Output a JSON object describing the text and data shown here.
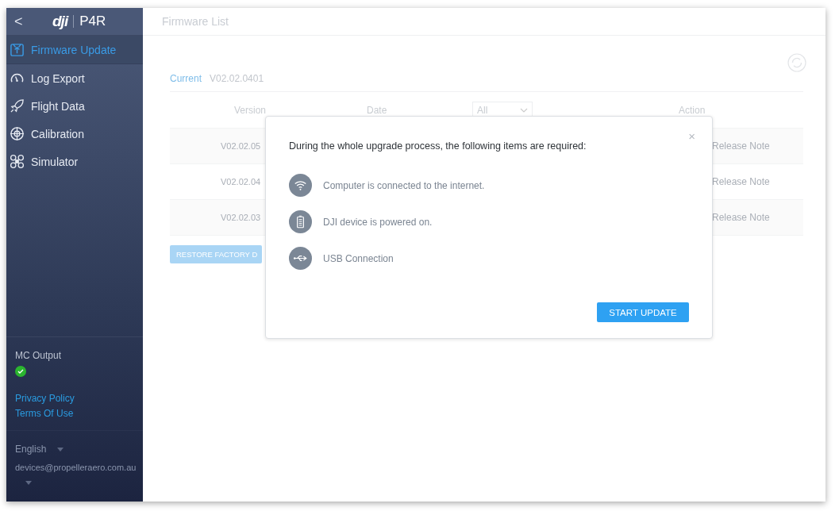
{
  "sidebar": {
    "back": "<",
    "logo": "dji",
    "model": "P4R",
    "items": [
      {
        "label": "Firmware Update",
        "kind": "firmware",
        "selected": true
      },
      {
        "label": "Log Export",
        "kind": "gauge",
        "selected": false
      },
      {
        "label": "Flight Data",
        "kind": "rocket",
        "selected": false
      },
      {
        "label": "Calibration",
        "kind": "target",
        "selected": false
      },
      {
        "label": "Simulator",
        "kind": "drone",
        "selected": false
      }
    ],
    "mc_output": {
      "label": "MC Output",
      "ok": true
    },
    "links": [
      "Privacy Policy",
      "Terms Of Use"
    ],
    "language": "English",
    "account": "devices@propelleraero.com.au"
  },
  "main": {
    "title": "Firmware List",
    "current_label": "Current",
    "current_version": "V02.02.0401",
    "table": {
      "columns": [
        "Version",
        "Date",
        "Action"
      ],
      "filter": "All",
      "rows": [
        {
          "version": "V02.02.05",
          "action": "Release Note"
        },
        {
          "version": "V02.02.04",
          "action": "Release Note"
        },
        {
          "version": "V02.02.03",
          "action": "Release Note"
        }
      ]
    },
    "restore_button": "RESTORE FACTORY D"
  },
  "dialog": {
    "message": "During the whole upgrade process, the following items are required:",
    "close": "×",
    "requirements": [
      {
        "kind": "wifi",
        "text": "Computer is connected to the internet."
      },
      {
        "kind": "battery",
        "text": "DJI device is powered on."
      },
      {
        "kind": "usb",
        "text": "USB Connection"
      }
    ],
    "button": "START UPDATE"
  }
}
